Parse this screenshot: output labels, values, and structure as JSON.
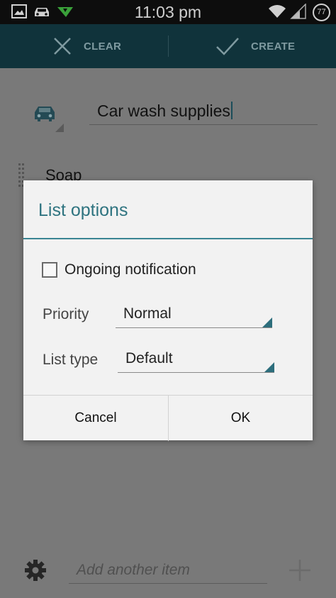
{
  "status_bar": {
    "time": "11:03 pm",
    "battery_level": "77",
    "icons": [
      "gallery-icon",
      "car-icon",
      "download-arrow-icon",
      "wifi-icon",
      "signal-icon",
      "battery-icon"
    ]
  },
  "action_bar": {
    "clear_label": "CLEAR",
    "create_label": "CREATE",
    "clear_icon": "close-icon",
    "create_icon": "check-icon"
  },
  "list": {
    "icon": "car-icon",
    "title": "Car wash supplies",
    "items": [
      "Soap"
    ],
    "add_item_placeholder": "Add another item"
  },
  "dialog": {
    "title": "List options",
    "ongoing_notification_label": "Ongoing notification",
    "ongoing_notification_checked": false,
    "priority_label": "Priority",
    "priority_value": "Normal",
    "list_type_label": "List type",
    "list_type_value": "Default",
    "cancel_label": "Cancel",
    "ok_label": "OK"
  },
  "colors": {
    "accent": "#3a8593",
    "action_bar": "#10333b",
    "status_bar": "#0d0d0d"
  }
}
